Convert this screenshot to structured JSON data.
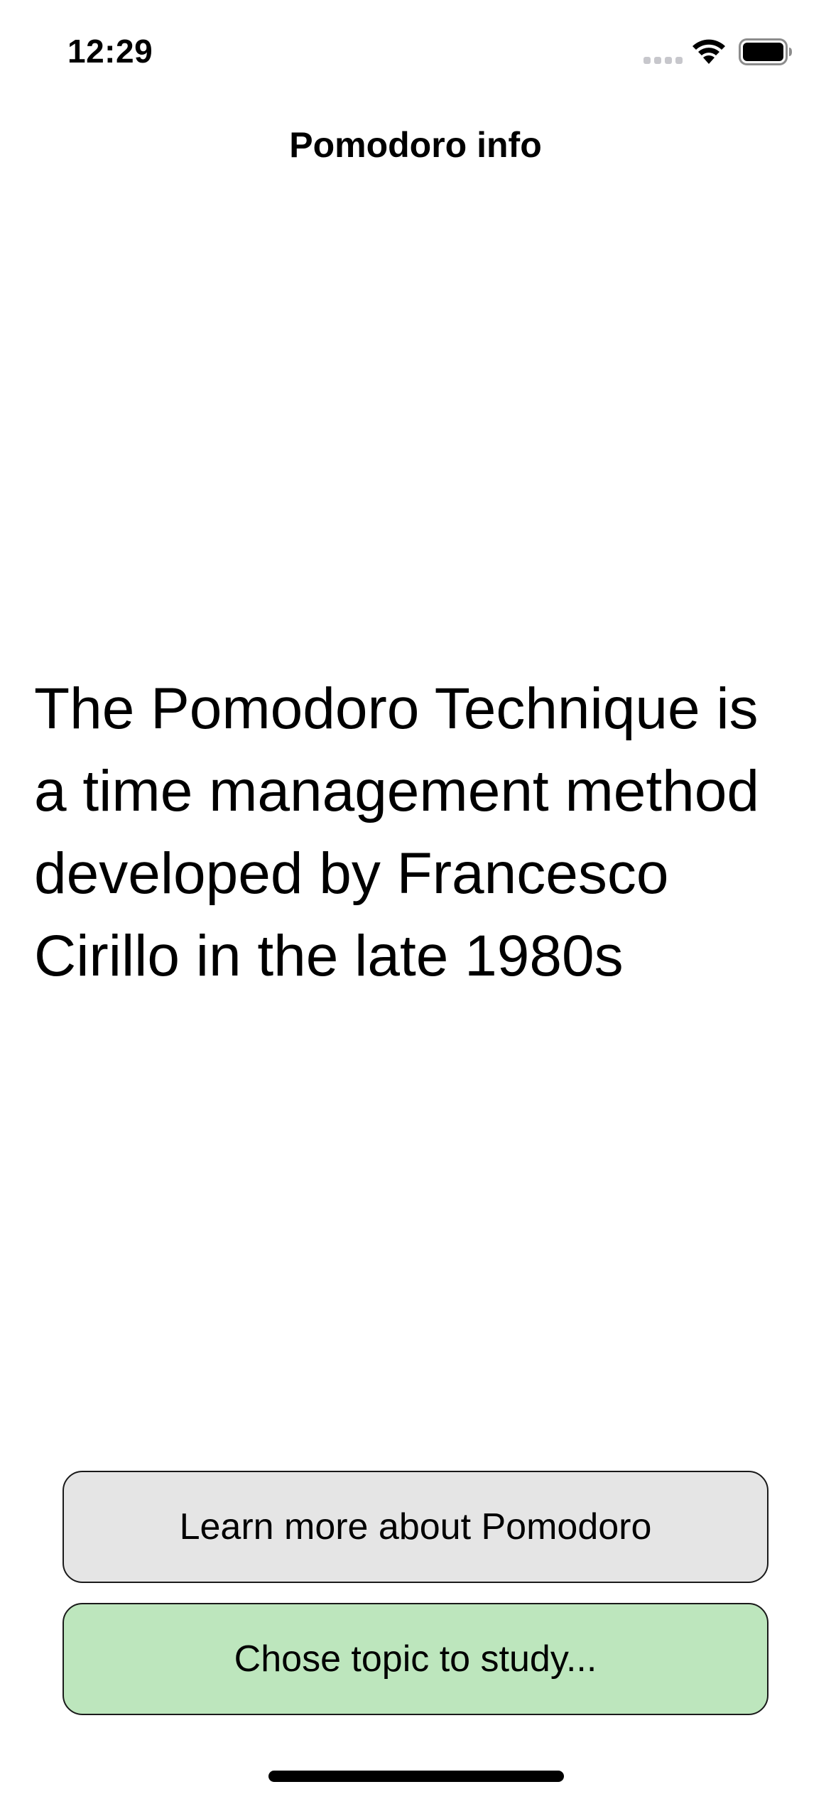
{
  "status_bar": {
    "time": "12:29",
    "icons": [
      "signal-icon",
      "wifi-icon",
      "battery-icon"
    ]
  },
  "nav": {
    "title": "Pomodoro info"
  },
  "content": {
    "description": "The Pomodoro Technique is a time management method developed by Francesco Cirillo in the late 1980s"
  },
  "buttons": {
    "learn_more": "Learn more about Pomodoro",
    "choose_topic": "Chose topic to study..."
  },
  "colors": {
    "learn_more_bg": "#e5e5e5",
    "choose_topic_bg": "#bde6bd"
  }
}
